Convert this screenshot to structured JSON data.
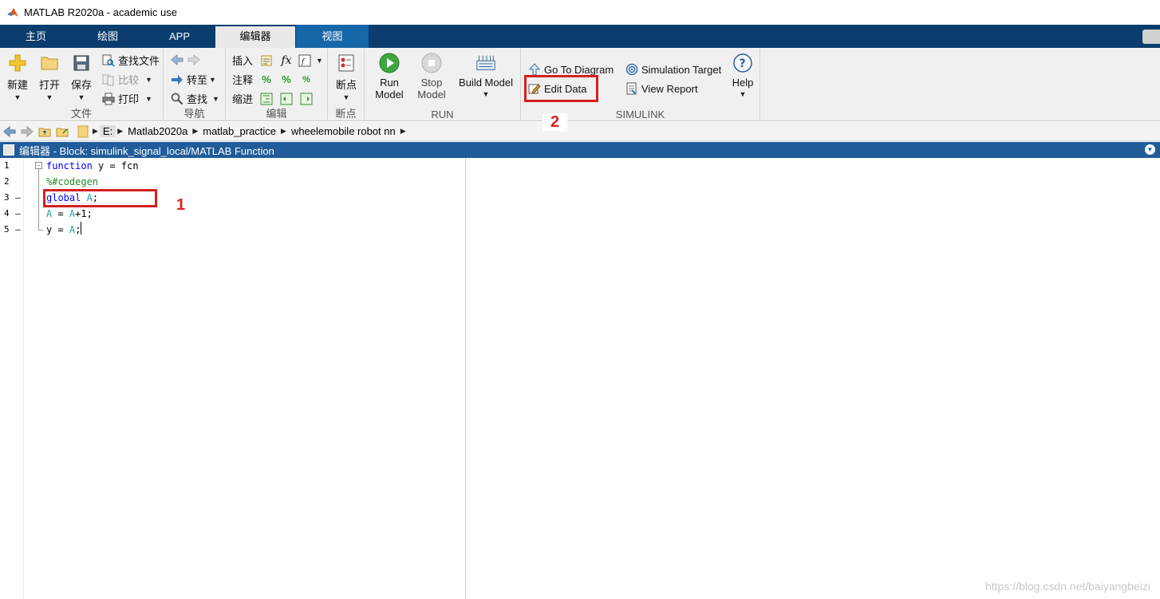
{
  "window": {
    "title": "MATLAB R2020a - academic use"
  },
  "tabs": [
    {
      "label": "主页"
    },
    {
      "label": "绘图"
    },
    {
      "label": "APP"
    },
    {
      "label": "编辑器",
      "active": true
    },
    {
      "label": "视图"
    }
  ],
  "ribbon": {
    "file": {
      "group_label": "文件",
      "new_label": "新建",
      "open_label": "打开",
      "save_label": "保存",
      "find_files_label": "查找文件",
      "compare_label": "比较",
      "print_label": "打印"
    },
    "navigate": {
      "group_label": "导航",
      "goto_label": "转至",
      "find_label": "查找"
    },
    "edit": {
      "group_label": "编辑",
      "insert_label": "插入",
      "comment_label": "注释",
      "indent_label": "缩进",
      "fx_label": "fx"
    },
    "breakpoints": {
      "group_label": "断点",
      "button_label": "断点"
    },
    "run": {
      "group_label": "RUN",
      "run_model_label": [
        "Run",
        "Model"
      ],
      "stop_model_label": [
        "Stop",
        "Model"
      ],
      "build_model_label": "Build Model"
    },
    "simulink": {
      "group_label": "SIMULINK",
      "go_to_diagram_label": "Go To Diagram",
      "edit_data_label": "Edit Data",
      "simulation_target_label": "Simulation Target",
      "view_report_label": "View Report",
      "help_label": "Help"
    }
  },
  "address": {
    "drive": "E:",
    "crumbs": [
      "Matlab2020a",
      "matlab_practice",
      "wheelemobile robot nn"
    ]
  },
  "editor": {
    "header": "编辑器 - Block: simulink_signal_local/MATLAB Function",
    "line_numbers": [
      "1",
      "2",
      "3",
      "4",
      "5"
    ],
    "line_markers": [
      "",
      "",
      "–",
      "–",
      "–"
    ],
    "lines": [
      {
        "kw": "function",
        "rest": " y = fcn"
      },
      {
        "comment": "%#codegen"
      },
      {
        "kw": "global",
        "var": "A",
        "tail": ";"
      },
      {
        "var": "A",
        "mid": " = ",
        "var2": "A",
        "tail": "+1;"
      },
      {
        "pre": "y = ",
        "var": "A",
        "tail": ";"
      }
    ]
  },
  "annotations": {
    "one": "1",
    "two": "2",
    "color": "#d42020"
  },
  "watermark": "https://blog.csdn.net/baiyangbeizi",
  "colors": {
    "tabbar": "#0b3d6e",
    "view_tab": "#1766a8",
    "editor_header": "#1f5c99"
  }
}
